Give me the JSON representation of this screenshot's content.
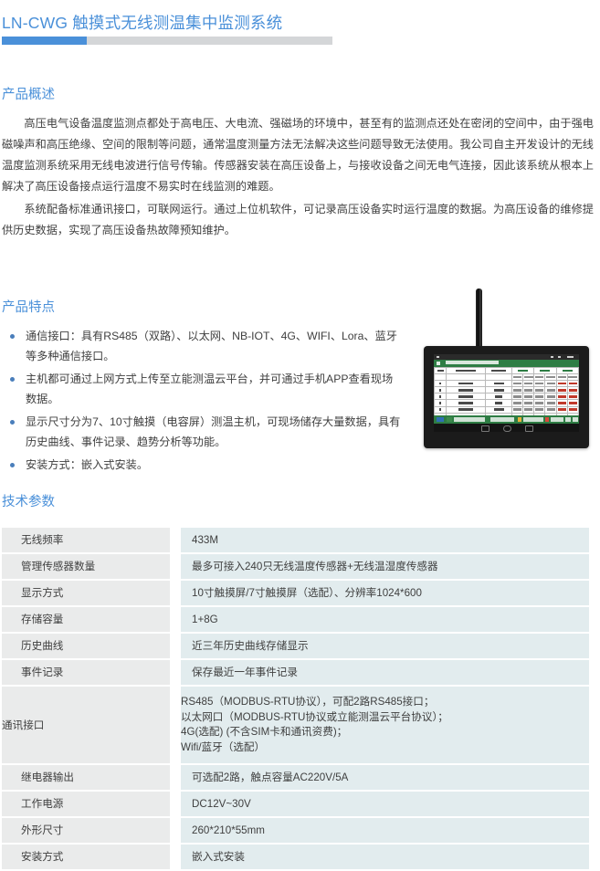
{
  "page": {
    "title": "LN-CWG 触摸式无线测温集中监测系统",
    "accent_color": "#4a90d9",
    "rule_color": "#d4d6d8"
  },
  "sections": {
    "overview": {
      "heading": "产品概述",
      "paragraphs": [
        "高压电气设备温度监测点都处于高电压、大电流、强磁场的环境中，甚至有的监测点还处在密闭的空间中，由于强电磁噪声和高压绝缘、空间的限制等问题，通常温度测量方法无法解决这些问题导致无法使用。我公司自主开发设计的无线温度监测系统采用无线电波进行信号传输。传感器安装在高压设备上，与接收设备之间无电气连接，因此该系统从根本上解决了高压设备接点运行温度不易实时在线监测的难题。",
        "系统配备标准通讯接口，可联网运行。通过上位机软件，可记录高压设备实时运行温度的数据。为高压设备的维修提供历史数据，实现了高压设备热故障预知维护。"
      ]
    },
    "features": {
      "heading": "产品特点",
      "bullet_color": "#4a7ebb",
      "items": [
        "通信接口：具有RS485（双路）、以太网、NB-IOT、4G、WIFI、Lora、蓝牙等多种通信接口。",
        "主机都可通过上网方式上传至立能测温云平台，并可通过手机APP查看现场数据。",
        "显示尺寸分为7、10寸触摸（电容屏）测温主机，可现场储存大量数据，具有历史曲线、事件记录、趋势分析等功能。",
        "安装方式：嵌入式安装。"
      ]
    },
    "specs": {
      "heading": "技术参数",
      "label_bg": "#eaebeb",
      "value_bg": "#e2ecee",
      "rows": [
        {
          "label": "无线频率",
          "value": "433M"
        },
        {
          "label": "管理传感器数量",
          "value": "最多可接入240只无线温度传感器+无线温湿度传感器"
        },
        {
          "label": "显示方式",
          "value": "10寸触摸屏/7寸触摸屏（选配）、分辨率1024*600"
        },
        {
          "label": "存储容量",
          "value": "1+8G"
        },
        {
          "label": "历史曲线",
          "value": "近三年历史曲线存储显示"
        },
        {
          "label": "事件记录",
          "value": "保存最近一年事件记录"
        },
        {
          "label": "继电器输出",
          "value": "可选配2路，触点容量AC220V/5A"
        },
        {
          "label": "工作电源",
          "value": "DC12V~30V"
        },
        {
          "label": "外形尺寸",
          "value": "260*210*55mm"
        },
        {
          "label": "安装方式",
          "value": "嵌入式安装"
        }
      ],
      "comm_row": {
        "label": "通讯接口",
        "lines": [
          "RS485（MODBUS-RTU协议），可配2路RS485接口；",
          "以太网口（MODBUS-RTU协议或立能测温云平台协议）；",
          "4G(选配) (不含SIM卡和通讯资费)；",
          "Wifi/蓝牙（选配）"
        ]
      }
    }
  },
  "device_photo": {
    "alt": "LN-CWG 触摸式测温主机",
    "screen": {
      "appbar_color": "#2e7d44",
      "bezel_color": "#1b1b1b"
    }
  }
}
